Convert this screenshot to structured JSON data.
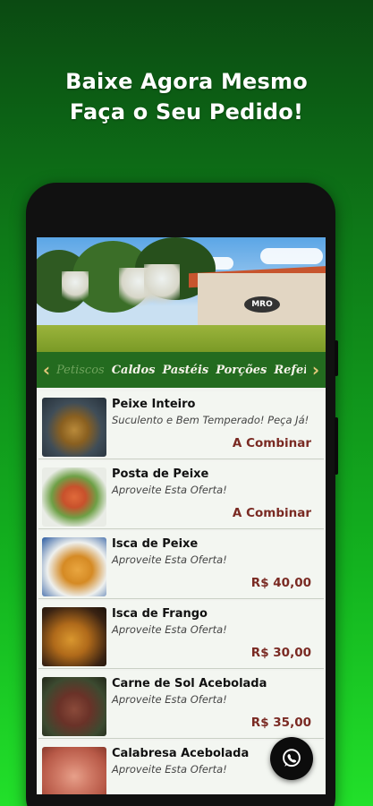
{
  "promo": {
    "line1": "Baixe Agora Mesmo",
    "line2": "Faça o Seu Pedido!"
  },
  "hero": {
    "sign_text": "MRO"
  },
  "category_bar": {
    "prev_icon": "chevron-left-icon",
    "next_icon": "chevron-right-icon",
    "categories": [
      "Petiscos",
      "Caldos",
      "Pastéis",
      "Porções",
      "Refei"
    ],
    "active_index": 0
  },
  "menu_items": [
    {
      "name": "Peixe Inteiro",
      "description": "Suculento e Bem Temperado! Peça Já!",
      "price": "A Combinar"
    },
    {
      "name": "Posta de Peixe",
      "description": "Aproveite Esta Oferta!",
      "price": "A Combinar"
    },
    {
      "name": "Isca de Peixe",
      "description": "Aproveite Esta Oferta!",
      "price": "R$ 40,00"
    },
    {
      "name": "Isca de Frango",
      "description": "Aproveite Esta Oferta!",
      "price": "R$ 30,00"
    },
    {
      "name": "Carne de Sol Acebolada",
      "description": "Aproveite Esta Oferta!",
      "price": "R$ 35,00"
    },
    {
      "name": "Calabresa Acebolada",
      "description": "Aproveite Esta Oferta!",
      "price": ""
    }
  ],
  "fab": {
    "icon": "whatsapp-icon"
  },
  "colors": {
    "category_bar": "#236b1f",
    "chevron": "#e3c77a",
    "price": "#7a2a23",
    "active_category": "#6ea35c"
  }
}
